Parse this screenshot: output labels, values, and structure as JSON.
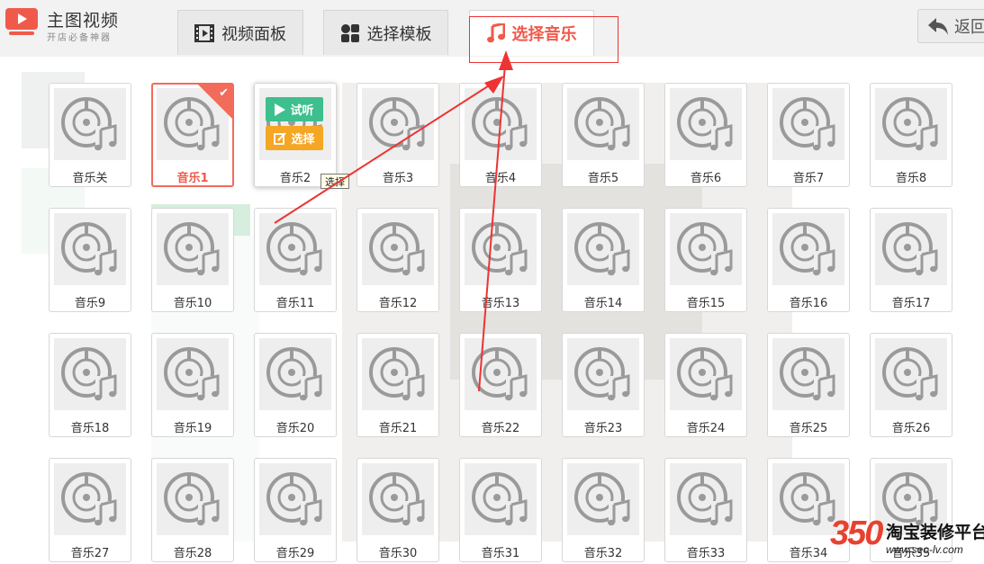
{
  "header": {
    "logo_title": "主图视频",
    "logo_subtitle": "开店必备神器",
    "back_label": "返回"
  },
  "tabs": [
    {
      "label": "视频面板",
      "icon": "film-icon",
      "active": false
    },
    {
      "label": "选择模板",
      "icon": "layout-icon",
      "active": false
    },
    {
      "label": "选择音乐",
      "icon": "music-note-icon",
      "active": true
    }
  ],
  "music_items": [
    {
      "label": "音乐关",
      "state": "normal"
    },
    {
      "label": "音乐1",
      "state": "selected"
    },
    {
      "label": "音乐2",
      "state": "hovered"
    },
    {
      "label": "音乐3",
      "state": "normal"
    },
    {
      "label": "音乐4",
      "state": "normal"
    },
    {
      "label": "音乐5",
      "state": "normal"
    },
    {
      "label": "音乐6",
      "state": "normal"
    },
    {
      "label": "音乐7",
      "state": "normal"
    },
    {
      "label": "音乐8",
      "state": "normal"
    },
    {
      "label": "音乐9",
      "state": "normal"
    },
    {
      "label": "音乐10",
      "state": "normal"
    },
    {
      "label": "音乐11",
      "state": "normal"
    },
    {
      "label": "音乐12",
      "state": "normal"
    },
    {
      "label": "音乐13",
      "state": "normal"
    },
    {
      "label": "音乐14",
      "state": "normal"
    },
    {
      "label": "音乐15",
      "state": "normal"
    },
    {
      "label": "音乐16",
      "state": "normal"
    },
    {
      "label": "音乐17",
      "state": "normal"
    },
    {
      "label": "音乐18",
      "state": "normal"
    },
    {
      "label": "音乐19",
      "state": "normal"
    },
    {
      "label": "音乐20",
      "state": "normal"
    },
    {
      "label": "音乐21",
      "state": "normal"
    },
    {
      "label": "音乐22",
      "state": "normal"
    },
    {
      "label": "音乐23",
      "state": "normal"
    },
    {
      "label": "音乐24",
      "state": "normal"
    },
    {
      "label": "音乐25",
      "state": "normal"
    },
    {
      "label": "音乐26",
      "state": "normal"
    },
    {
      "label": "音乐27",
      "state": "normal"
    },
    {
      "label": "音乐28",
      "state": "normal"
    },
    {
      "label": "音乐29",
      "state": "normal"
    },
    {
      "label": "音乐30",
      "state": "normal"
    },
    {
      "label": "音乐31",
      "state": "normal"
    },
    {
      "label": "音乐32",
      "state": "normal"
    },
    {
      "label": "音乐33",
      "state": "normal"
    },
    {
      "label": "音乐34",
      "state": "normal"
    },
    {
      "label": "音乐35",
      "state": "normal"
    }
  ],
  "hover_actions": {
    "listen_label": "试听",
    "choose_label": "选择"
  },
  "tooltip": "选择",
  "watermark": {
    "number": "350",
    "name": "淘宝装修平台",
    "url": "www.seo-lv.com"
  },
  "colors": {
    "accent": "#f05a4a",
    "listen": "#3dbf8e",
    "choose": "#f5a623",
    "annotation": "#e33333"
  }
}
